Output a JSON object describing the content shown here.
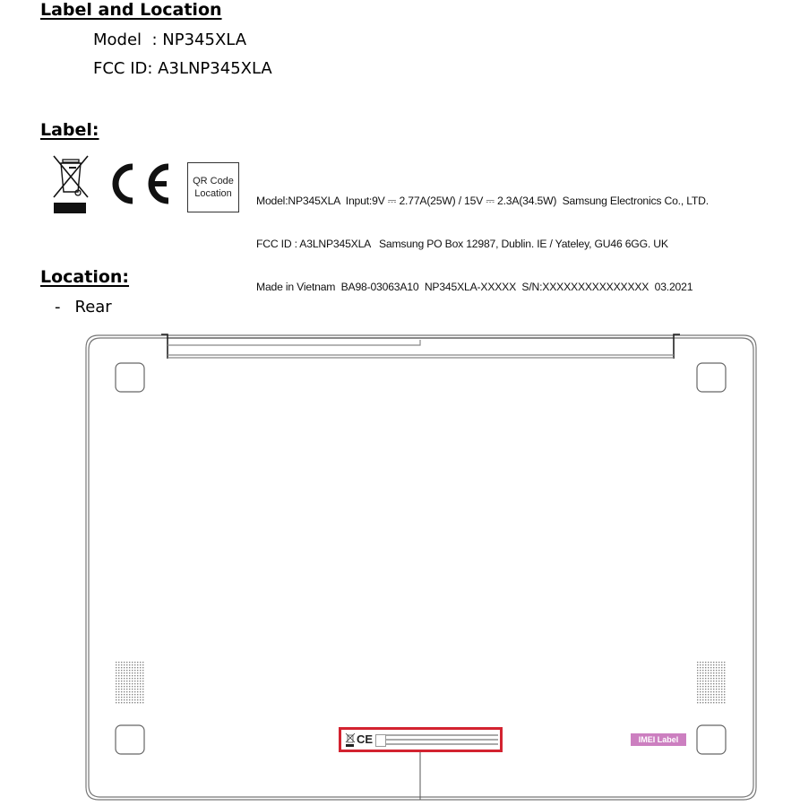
{
  "heading": "Label and Location",
  "model_line": {
    "label": "Model  ",
    "value": ": NP345XLA"
  },
  "fcc_line": {
    "label": "FCC ID",
    "value": ": A3LNP345XLA"
  },
  "label_section": {
    "title": "Label:",
    "icons": [
      "weee-crossed-bin-icon",
      "ce-mark-icon"
    ],
    "qr_box": {
      "line1": "QR Code",
      "line2": "Location"
    },
    "text_lines": [
      "Model:NP345XLA  Input:9V ⎓ 2.77A(25W) / 15V ⎓ 2.3A(34.5W)  Samsung Electronics Co., LTD.",
      "FCC ID : A3LNP345XLA   Samsung PO Box 12987, Dublin. IE / Yateley, GU46 6GG. UK",
      "Made in Vietnam  BA98-03063A10  NP345XLA-XXXXX  S/N:XXXXXXXXXXXXXXX  03.2021"
    ]
  },
  "location_section": {
    "title": "Location:",
    "bullet": "-",
    "item": "Rear"
  },
  "diagram": {
    "highlight_color": "#d32330",
    "imei_label": "IMEI Label",
    "imei_color": "#cc7fc0"
  }
}
